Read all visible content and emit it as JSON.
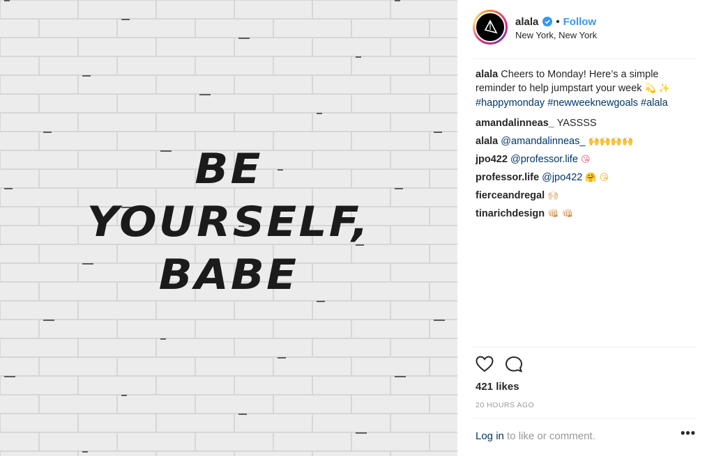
{
  "photo": {
    "quote_lines": [
      "BE",
      "YOURSELF,",
      "BABE"
    ]
  },
  "post": {
    "username": "alala",
    "dot": "•",
    "follow_label": "Follow",
    "location": "New York, New York",
    "caption": {
      "username": "alala",
      "text": "Cheers to Monday! Here’s a simple reminder to help jumpstart your week",
      "emoji": "💫 ✨",
      "hashtags": [
        "#happymonday",
        "#newweeknewgoals",
        "#alala"
      ]
    },
    "comments": [
      {
        "username": "amandalinneas_",
        "text": "YASSSS",
        "mention": "",
        "emoji": ""
      },
      {
        "username": "alala",
        "text": "",
        "mention": "@amandalinneas_",
        "emoji": "🙌🙌🙌🙌"
      },
      {
        "username": "jpo422",
        "text": "",
        "mention": "@professor.life",
        "emoji": "😘"
      },
      {
        "username": "professor.life",
        "text": "",
        "mention": "@jpo422",
        "emoji": "🤗 😘"
      },
      {
        "username": "fierceandregal",
        "text": "",
        "mention": "",
        "emoji": "🙌🏻"
      },
      {
        "username": "tinarichdesign",
        "text": "",
        "mention": "",
        "emoji": "👊🏻 👊🏻"
      }
    ],
    "likes": "421 likes",
    "time": "20 HOURS AGO",
    "login_label": "Log in",
    "login_suffix": " to like or comment.",
    "more_label": "•••"
  },
  "icons": {
    "avatar": "alala-logo-icon",
    "verified": "verified-badge-icon",
    "like": "heart-icon",
    "comment": "comment-bubble-icon",
    "more": "more-options-icon"
  },
  "colors": {
    "accent": "#3897f0",
    "link": "#003569",
    "muted": "#999999",
    "text": "#262626"
  }
}
